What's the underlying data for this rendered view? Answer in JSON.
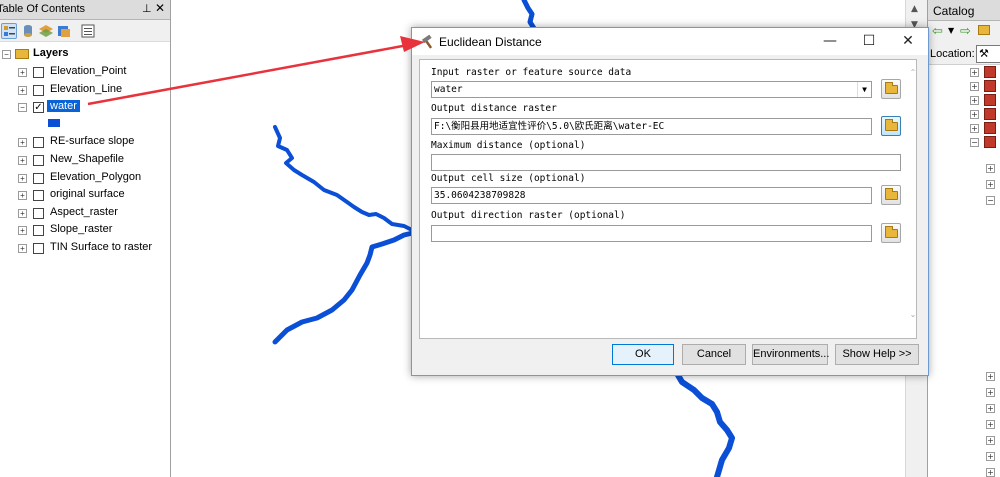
{
  "toc": {
    "title": "Table Of Contents",
    "pin_icon": "pin-icon",
    "close_glyph": "✕",
    "root_label": "Layers",
    "layers": [
      {
        "label": "Elevation_Point",
        "checked": false
      },
      {
        "label": "Elevation_Line",
        "checked": false
      },
      {
        "label": "water",
        "checked": true,
        "selected": true,
        "expanded": true,
        "symbol_color": "#0a4fd6"
      },
      {
        "label": "RE-surface slope",
        "checked": false
      },
      {
        "label": "New_Shapefile",
        "checked": false
      },
      {
        "label": "Elevation_Polygon",
        "checked": false
      },
      {
        "label": "original surface",
        "checked": false
      },
      {
        "label": "Aspect_raster",
        "checked": false
      },
      {
        "label": "Slope_raster",
        "checked": false
      },
      {
        "label": "TIN Surface to raster",
        "checked": false
      }
    ]
  },
  "catalog": {
    "title": "Catalog",
    "location_label": "Location:"
  },
  "dialog": {
    "title": "Euclidean Distance",
    "params": [
      {
        "label": "Input raster or feature source data",
        "value": "water",
        "type": "dropdown"
      },
      {
        "label": "Output distance raster",
        "value": "F:\\衡阳县用地适宜性评价\\5.0\\欧氏距离\\water-EC",
        "type": "file"
      },
      {
        "label": "Maximum distance (optional)",
        "value": "",
        "type": "text"
      },
      {
        "label": "Output cell size (optional)",
        "value": "35.0604238709828",
        "type": "file"
      },
      {
        "label": "Output direction raster (optional)",
        "value": "",
        "type": "file"
      }
    ],
    "buttons": {
      "ok": "OK",
      "cancel": "Cancel",
      "environments": "Environments...",
      "show_help": "Show Help >>"
    }
  },
  "colors": {
    "river": "#0a4fd6",
    "annotation_arrow": "#e8323c",
    "selection": "#0a63d6"
  }
}
